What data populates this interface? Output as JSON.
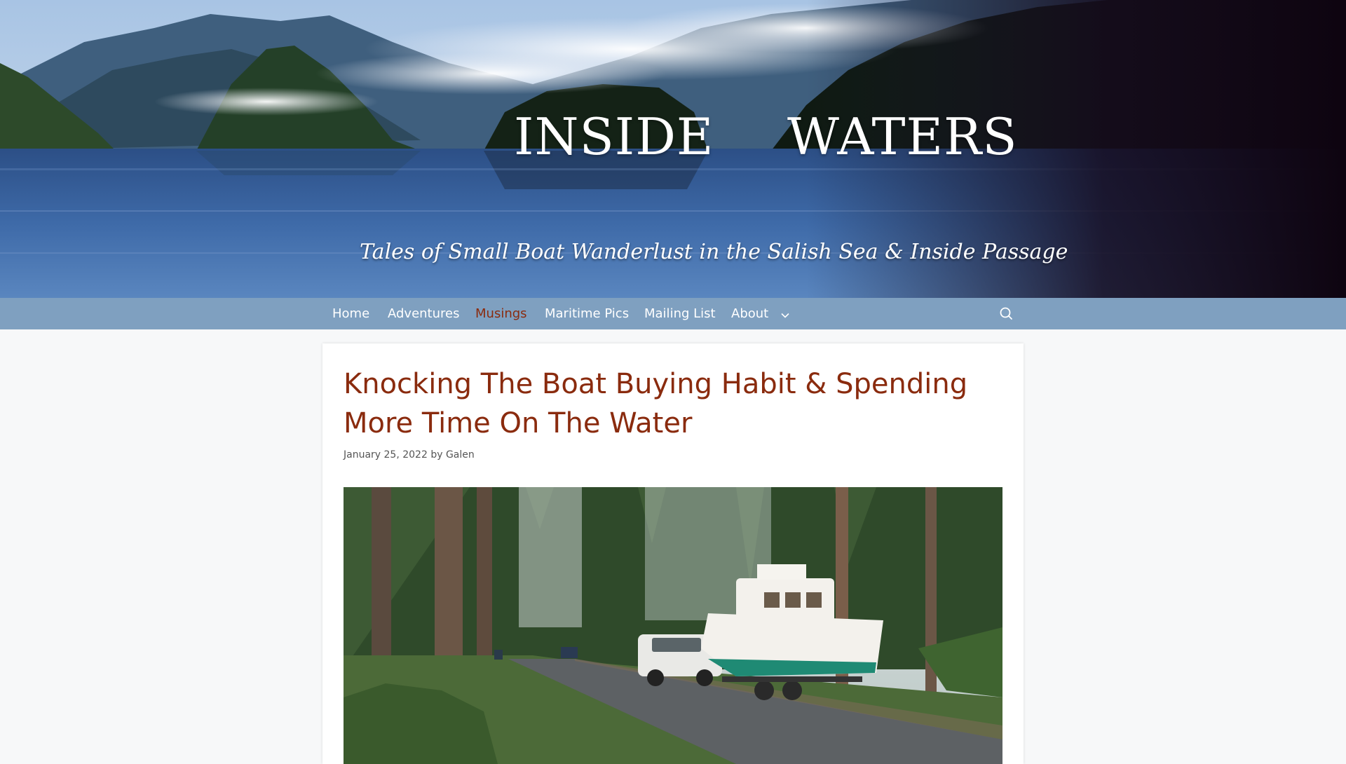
{
  "header": {
    "title_word_1": "INSIDE",
    "title_word_2": "WATERS",
    "tagline": "Tales of Small Boat Wanderlust in the Salish Sea & Inside Passage"
  },
  "nav": {
    "items": [
      {
        "label": "Home"
      },
      {
        "label": "Adventures"
      },
      {
        "label": "Musings",
        "active": true
      },
      {
        "label": "Maritime Pics"
      },
      {
        "label": "Mailing List"
      },
      {
        "label": "About",
        "has_dropdown": true
      }
    ],
    "search_icon": "search-icon"
  },
  "post": {
    "title": "Knocking The Boat Buying Habit & Spending More Time On The Water",
    "date": "January 25, 2022",
    "by": "by",
    "author": "Galen"
  },
  "colors": {
    "nav_background": "#7fa0c0",
    "accent": "#8a2b0e",
    "page_background": "#f7f8f9",
    "card_background": "#ffffff"
  }
}
